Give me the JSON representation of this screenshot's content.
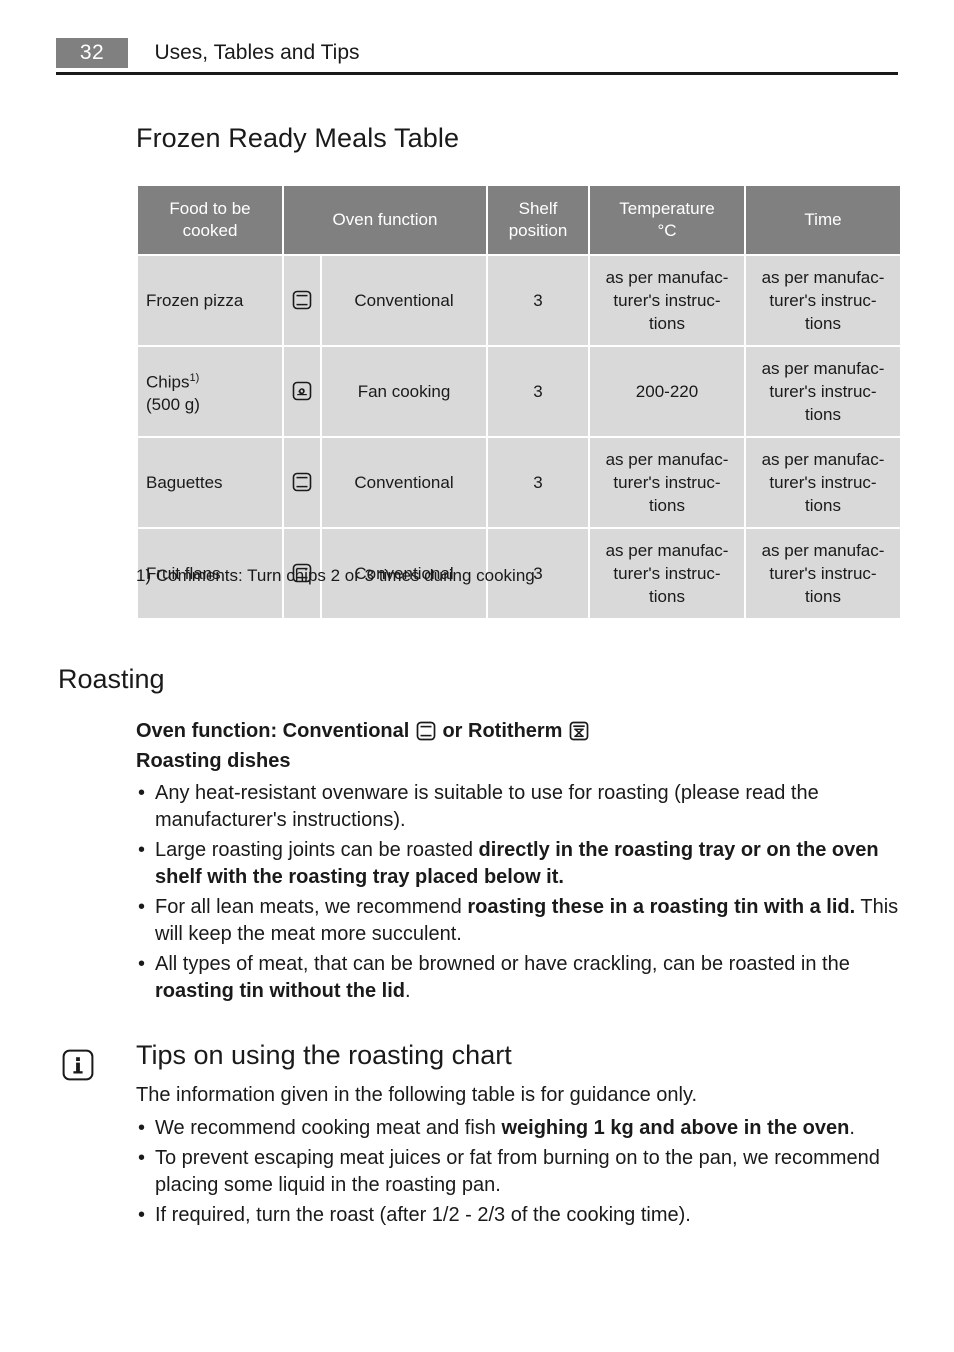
{
  "header": {
    "page_number": "32",
    "title": "Uses, Tables and Tips"
  },
  "section_frozen": {
    "heading": "Frozen Ready Meals Table",
    "table": {
      "columns": [
        "Food to be cooked",
        "Oven function",
        "Shelf position",
        "Temperature °C",
        "Time"
      ],
      "column_lines": {
        "food": [
          "Food to be",
          "cooked"
        ],
        "oven_function": "Oven function",
        "shelf": [
          "Shelf",
          "position"
        ],
        "temperature": [
          "Temperature",
          "°C"
        ],
        "time": "Time"
      },
      "rows": [
        {
          "food": "Frozen pizza",
          "food_sup": "",
          "food_line2": "",
          "icon": "conventional-oven-icon",
          "function": "Conventional",
          "shelf": "3",
          "temperature": "as per manufac-turer's instruc-tions",
          "time": "as per manufac-turer's instruc-tions"
        },
        {
          "food": "Chips",
          "food_sup": "1)",
          "food_line2": "(500 g)",
          "icon": "fan-cooking-icon",
          "function": "Fan cooking",
          "shelf": "3",
          "temperature": "200-220",
          "time": "as per manufac-turer's instruc-tions"
        },
        {
          "food": "Baguettes",
          "food_sup": "",
          "food_line2": "",
          "icon": "conventional-oven-icon",
          "function": "Conventional",
          "shelf": "3",
          "temperature": "as per manufac-turer's instruc-tions",
          "time": "as per manufac-turer's instruc-tions"
        },
        {
          "food": "Fruit flans",
          "food_sup": "",
          "food_line2": "",
          "icon": "conventional-oven-icon",
          "function": "Conventional",
          "shelf": "3",
          "temperature": "as per manufac-turer's instruc-tions",
          "time": "as per manufac-turer's instruc-tions"
        }
      ],
      "footnote": "1) Comments: Turn chips 2 or 3 times during cooking"
    }
  },
  "section_roasting": {
    "heading": "Roasting",
    "oven_function_prefix": "Oven function: Conventional",
    "oven_function_middle": "or Rotitherm",
    "subheading": "Roasting dishes",
    "bullets": [
      {
        "parts": [
          {
            "text": "Any heat-resistant ovenware is suitable to use for roasting (please read the manufacturer's instructions).",
            "bold": false
          }
        ]
      },
      {
        "parts": [
          {
            "text": "Large roasting joints can be roasted ",
            "bold": false
          },
          {
            "text": "directly in the roasting tray or on the oven shelf with the roasting tray placed below it.",
            "bold": true
          }
        ]
      },
      {
        "parts": [
          {
            "text": "For all lean meats, we recommend ",
            "bold": false
          },
          {
            "text": "roasting these in a roasting tin with a lid.",
            "bold": true
          },
          {
            "text": " This will keep the meat more succulent.",
            "bold": false
          }
        ]
      },
      {
        "parts": [
          {
            "text": "All types of meat, that can be browned or have crackling, can be roasted in the ",
            "bold": false
          },
          {
            "text": "roasting tin without the lid",
            "bold": true
          },
          {
            "text": ".",
            "bold": false
          }
        ]
      }
    ]
  },
  "section_tips": {
    "icon": "info-icon",
    "heading": "Tips on using the roasting chart",
    "intro": "The information given in the following table is for guidance only.",
    "bullets": [
      {
        "parts": [
          {
            "text": "We recommend cooking meat and fish ",
            "bold": false
          },
          {
            "text": "weighing 1 kg and above in the oven",
            "bold": true
          },
          {
            "text": ".",
            "bold": false
          }
        ]
      },
      {
        "parts": [
          {
            "text": "To prevent escaping meat juices or fat from burning on to the pan, we recommend placing some liquid in the roasting pan.",
            "bold": false
          }
        ]
      },
      {
        "parts": [
          {
            "text": "If required, turn the roast (after 1/2 - 2/3 of the cooking time).",
            "bold": false
          }
        ]
      }
    ]
  },
  "colors": {
    "header_badge": "#808080",
    "table_header": "#808080",
    "table_cell": "#d9d9d9",
    "text": "#1a1a1a"
  }
}
